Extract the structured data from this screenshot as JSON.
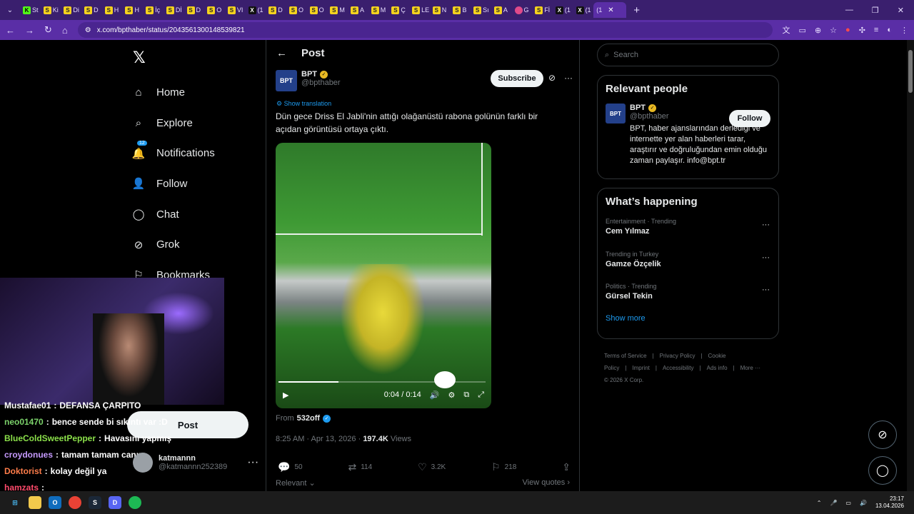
{
  "browser": {
    "tabs": [
      {
        "fav": "K",
        "label": "St",
        "cls": "k"
      },
      {
        "fav": "S",
        "label": "Ki",
        "cls": ""
      },
      {
        "fav": "S",
        "label": "Di",
        "cls": ""
      },
      {
        "fav": "S",
        "label": "D",
        "cls": ""
      },
      {
        "fav": "S",
        "label": "H",
        "cls": ""
      },
      {
        "fav": "S",
        "label": "H",
        "cls": ""
      },
      {
        "fav": "S",
        "label": "İç",
        "cls": ""
      },
      {
        "fav": "S",
        "label": "Dİ",
        "cls": ""
      },
      {
        "fav": "S",
        "label": "D",
        "cls": ""
      },
      {
        "fav": "S",
        "label": "O",
        "cls": ""
      },
      {
        "fav": "S",
        "label": "VI",
        "cls": ""
      },
      {
        "fav": "X",
        "label": "(1",
        "cls": "x"
      },
      {
        "fav": "S",
        "label": "D",
        "cls": ""
      },
      {
        "fav": "S",
        "label": "O",
        "cls": ""
      },
      {
        "fav": "S",
        "label": "O",
        "cls": ""
      },
      {
        "fav": "S",
        "label": "M",
        "cls": ""
      },
      {
        "fav": "S",
        "label": "A",
        "cls": ""
      },
      {
        "fav": "S",
        "label": "M",
        "cls": ""
      },
      {
        "fav": "S",
        "label": "Ç",
        "cls": ""
      },
      {
        "fav": "S",
        "label": "LE",
        "cls": ""
      },
      {
        "fav": "S",
        "label": "N",
        "cls": ""
      },
      {
        "fav": "S",
        "label": "B",
        "cls": ""
      },
      {
        "fav": "S",
        "label": "Sı",
        "cls": ""
      },
      {
        "fav": "S",
        "label": "A",
        "cls": ""
      },
      {
        "fav": "",
        "label": "G",
        "cls": "g"
      },
      {
        "fav": "S",
        "label": "Fİ",
        "cls": ""
      },
      {
        "fav": "X",
        "label": "(1",
        "cls": "x"
      },
      {
        "fav": "X",
        "label": "(1",
        "cls": "x"
      }
    ],
    "active_tab_label": "(1",
    "url": "x.com/bpthaber/status/2043561300148539821"
  },
  "sidebar": {
    "items": [
      {
        "name": "home",
        "label": "Home",
        "icon": "⌂"
      },
      {
        "name": "explore",
        "label": "Explore",
        "icon": "⌕"
      },
      {
        "name": "notifications",
        "label": "Notifications",
        "icon": "🔔"
      },
      {
        "name": "follow",
        "label": "Follow",
        "icon": "👤"
      },
      {
        "name": "chat",
        "label": "Chat",
        "icon": "◯"
      },
      {
        "name": "grok",
        "label": "Grok",
        "icon": "⊘"
      },
      {
        "name": "bookmarks",
        "label": "Bookmarks",
        "icon": "⚐"
      }
    ],
    "notif_count": "12",
    "post_label": "Post",
    "user": {
      "name": "katmannn",
      "handle": "@katmannn252389"
    }
  },
  "chat": [
    {
      "user": "Mustafae01",
      "msg": "DEFANSA ÇARPITO",
      "color": "#ffffff"
    },
    {
      "user": "neo01470",
      "msg": "bence sende bi sıkıntı var :D",
      "color": "#7cd36b"
    },
    {
      "user": "BlueColdSweetPepper",
      "msg": "Havasını yapmış",
      "color": "#8be04a"
    },
    {
      "user": "croydonues",
      "msg": "tamam tamam canım",
      "color": "#c79bff"
    },
    {
      "user": "Doktorist",
      "msg": "kolay değil ya",
      "color": "#ff7d4a"
    },
    {
      "user": "hamzats",
      "msg": "",
      "color": "#ff4a6b"
    }
  ],
  "post": {
    "header_title": "Post",
    "author_name": "BPT",
    "author_handle": "@bpthaber",
    "avatar_text": "BPT",
    "subscribe_label": "Subscribe",
    "show_translation": "Show translation",
    "text": "Dün gece Driss El Jabli'nin attığı olağanüstü rabona golünün farklı bir açıdan görüntüsü ortaya çıktı.",
    "video": {
      "time": "0:04 / 0:14",
      "progress": 0.29
    },
    "from_label": "From",
    "from_account": "532off",
    "timestamp": "8:25 AM · Apr 13, 2026 ·",
    "views_count": "197.4K",
    "views_label": "Views",
    "replies": "50",
    "reposts": "114",
    "likes": "3.2K",
    "bookmarks": "218",
    "relevant_label": "Relevant ⌄",
    "view_quotes_label": "View quotes ›"
  },
  "right": {
    "search_placeholder": "Search",
    "relevant_title": "Relevant people",
    "person": {
      "name": "BPT",
      "handle": "@bpthaber",
      "bio": "BPT, haber ajanslarından derlediği ve internette yer alan haberleri tarar, araştırır ve doğruluğundan emin olduğu zaman paylaşır. info@bpt.tr",
      "follow_label": "Follow"
    },
    "happening_title": "What’s happening",
    "trends": [
      {
        "category": "Entertainment · Trending",
        "name": "Cem Yılmaz"
      },
      {
        "category": "Trending in Turkey",
        "name": "Gamze Özçelik"
      },
      {
        "category": "Politics · Trending",
        "name": "Gürsel Tekin"
      }
    ],
    "show_more": "Show more",
    "footer_links": [
      "Terms of Service",
      "|",
      "Privacy Policy",
      "|",
      "Cookie Policy",
      "|",
      "Imprint",
      "|",
      "Accessibility",
      "|",
      "Ads info",
      "|",
      "More ···"
    ],
    "copyright": "© 2026 X Corp."
  },
  "taskbar": {
    "time": "23:17",
    "date": "13.04.2026"
  }
}
